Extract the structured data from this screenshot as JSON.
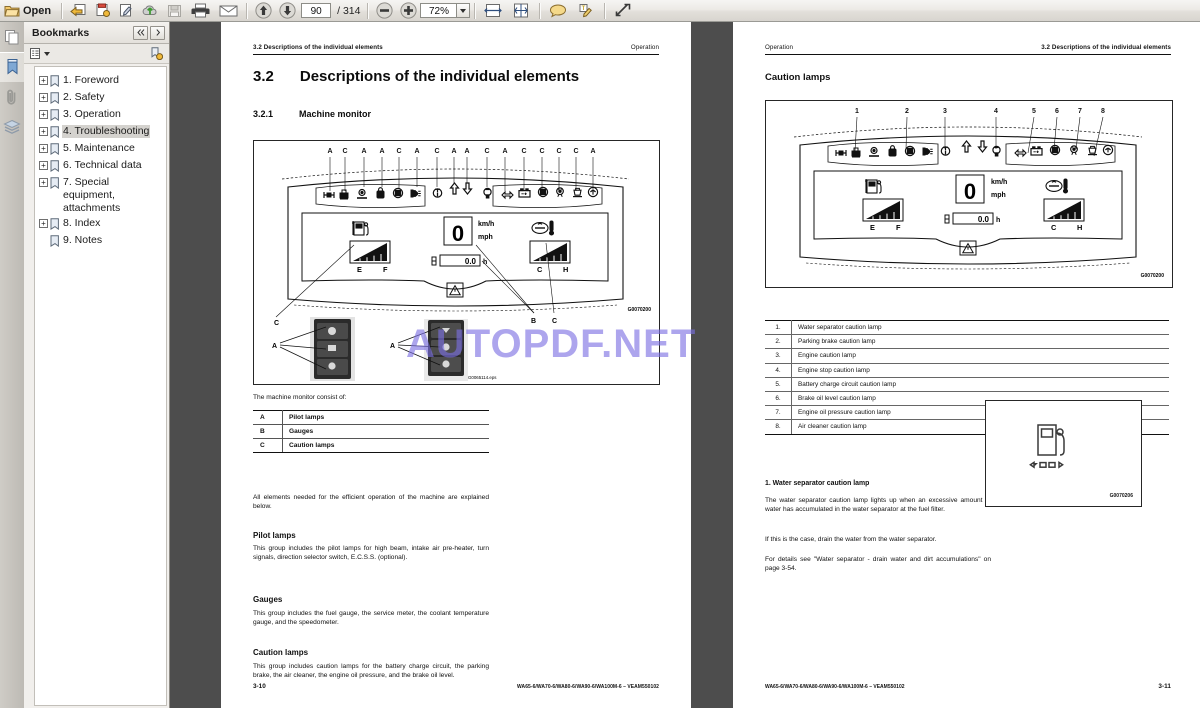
{
  "toolbar": {
    "open_label": "Open",
    "page_current": "90",
    "page_total": "/ 314",
    "zoom_value": "72%",
    "icons": [
      "folder-open-icon",
      "snapshot-icon",
      "sticky-note-icon",
      "sign-icon",
      "upload-cloud-icon",
      "save-icon",
      "print-icon",
      "email-icon",
      "previous-page-icon",
      "next-page-icon",
      "zoom-out-icon",
      "zoom-in-icon",
      "zoom-dropdown-icon",
      "fit-width-icon",
      "fit-page-icon",
      "comment-icon",
      "highlight-icon",
      "expand-icon"
    ]
  },
  "rail": {
    "items": [
      {
        "name": "page-thumbnails-icon",
        "active": false
      },
      {
        "name": "bookmarks-icon",
        "active": true
      },
      {
        "name": "attachments-icon",
        "active": false
      },
      {
        "name": "layers-icon",
        "active": false
      }
    ]
  },
  "bookmarks": {
    "title": "Bookmarks",
    "prev_label": "◄◄",
    "next_label": "►",
    "options_icon": "bookmark-options-icon",
    "new_bookmark_icon": "new-bookmark-icon",
    "items": [
      {
        "label": "1. Foreword",
        "expandable": true,
        "selected": false
      },
      {
        "label": "2. Safety",
        "expandable": true,
        "selected": false
      },
      {
        "label": "3. Operation",
        "expandable": true,
        "selected": false
      },
      {
        "label": "4. Troubleshooting",
        "expandable": true,
        "selected": true
      },
      {
        "label": "5. Maintenance",
        "expandable": true,
        "selected": false
      },
      {
        "label": "6. Technical data",
        "expandable": true,
        "selected": false
      },
      {
        "label": "7. Special equipment, attachments",
        "expandable": true,
        "selected": false
      },
      {
        "label": "8. Index",
        "expandable": true,
        "selected": false
      },
      {
        "label": "9. Notes",
        "expandable": false,
        "selected": false
      }
    ]
  },
  "watermark": {
    "text": "AUTOPDF.NET",
    "color": "#7b6fe3"
  },
  "left_page": {
    "running_head_left": "3.2  Descriptions of the individual elements",
    "running_head_right": "Operation",
    "section_number": "3.2",
    "section_title": "Descriptions of the individual elements",
    "sub_number": "3.2.1",
    "sub_title": "Machine monitor",
    "figure_id": "G0070200",
    "figure_id_2": "G0065114.eps",
    "callouts_top": [
      "A",
      "C",
      "A",
      "A",
      "C",
      "A",
      "C",
      "A",
      "A",
      "C",
      "A",
      "C",
      "C",
      "C",
      "C",
      "A"
    ],
    "callouts_other": [
      "C",
      "A",
      "A",
      "B",
      "C"
    ],
    "gauge_speed": "0",
    "gauge_speed_unit_1": "km/h",
    "gauge_speed_unit_2": "mph",
    "gauge_hours": "0.0",
    "gauge_hours_unit": "h",
    "fuel_min": "E",
    "fuel_max": "F",
    "temp_min": "C",
    "temp_max": "H",
    "intro_text": "The machine monitor consist of:",
    "legend_table": [
      {
        "key": "A",
        "value": "Pilot lamps"
      },
      {
        "key": "B",
        "value": "Gauges"
      },
      {
        "key": "C",
        "value": "Caution lamps"
      }
    ],
    "after_table": "All elements needed for the efficient operation of the machine are explained below.",
    "sections": [
      {
        "heading": "Pilot lamps",
        "body": "This group includes the pilot lamps for high beam, intake air pre-heater, turn signals, direction selector switch, E.C.S.S. (optional)."
      },
      {
        "heading": "Gauges",
        "body": "This group includes the fuel gauge, the service meter, the coolant temperature gauge, and the speedometer."
      },
      {
        "heading": "Caution lamps",
        "body": "This group includes caution lamps for the battery charge circuit, the parking brake, the air cleaner, the engine oil pressure, and the brake oil level."
      }
    ],
    "page_number": "3-10",
    "footer_doc_id": "WA65-6/WA70-6/WA80-6/WA90-6/WA100M-6 – VEAM550102"
  },
  "right_page": {
    "running_head_left": "Operation",
    "running_head_right": "3.2  Descriptions of the individual elements",
    "heading": "Caution lamps",
    "figure_id": "G0070200",
    "figure_id_2": "G0070206",
    "callouts": [
      "1",
      "2",
      "3",
      "4",
      "5",
      "6",
      "7",
      "8"
    ],
    "gauge_speed": "0",
    "gauge_speed_unit_1": "km/h",
    "gauge_speed_unit_2": "mph",
    "gauge_hours": "0.0",
    "gauge_hours_unit": "h",
    "fuel_min": "E",
    "fuel_max": "F",
    "temp_min": "C",
    "temp_max": "H",
    "lamp_table": [
      {
        "num": "1.",
        "label": "Water separator caution lamp"
      },
      {
        "num": "2.",
        "label": "Parking brake caution lamp"
      },
      {
        "num": "3.",
        "label": "Engine caution lamp"
      },
      {
        "num": "4.",
        "label": "Engine stop caution lamp"
      },
      {
        "num": "5.",
        "label": "Battery charge circuit caution lamp"
      },
      {
        "num": "6.",
        "label": "Brake oil level caution lamp"
      },
      {
        "num": "7.",
        "label": "Engine oil pressure caution lamp"
      },
      {
        "num": "8.",
        "label": "Air cleaner caution lamp"
      }
    ],
    "item_heading": "1.   Water separator caution lamp",
    "item_paras": [
      "The water separator caution lamp lights up when an excessive amount of water has accumulated in the water separator at the fuel filter.",
      "If this is the case, drain the water from the water separator.",
      "For details see \"Water separator - drain water and dirt accumulations\" on page 3-54."
    ],
    "page_number": "3-11",
    "footer_doc_id": "WA65-6/WA70-6/WA80-6/WA90-6/WA100M-6 – VEAM550102"
  }
}
